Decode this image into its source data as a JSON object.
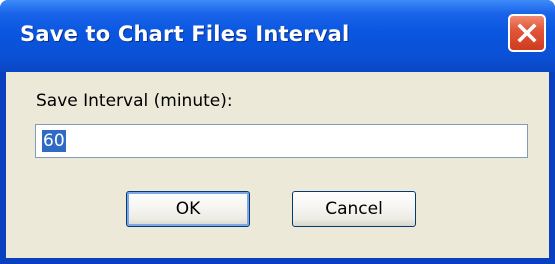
{
  "window": {
    "title": "Save to Chart Files Interval",
    "close_icon": "close-icon"
  },
  "form": {
    "label": "Save Interval (minute):",
    "interval_value": "60"
  },
  "buttons": {
    "ok": "OK",
    "cancel": "Cancel"
  },
  "colors": {
    "titlebar": "#0a56e0",
    "client_bg": "#ece9d8",
    "close_button": "#e2563a",
    "selection": "#316ac5"
  }
}
